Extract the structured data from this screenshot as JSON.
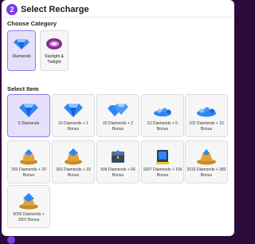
{
  "step": {
    "number": "2",
    "title": "Select Recharge"
  },
  "category_section": {
    "label": "Choose Category",
    "items": [
      {
        "label": "Diamonds",
        "selected": true
      },
      {
        "label": "Starlight & Twilight",
        "selected": false
      }
    ]
  },
  "item_section": {
    "label": "Select Item",
    "items": [
      {
        "label": "5 Diamonds",
        "selected": true
      },
      {
        "label": "10 Diamonds + 1 Bonus"
      },
      {
        "label": "20 Diamonds + 2 Bonus"
      },
      {
        "label": "51 Diamonds + 5 Bonus"
      },
      {
        "label": "102 Diamonds + 10 Bonus"
      },
      {
        "label": "203 Diamonds + 20 Bonus"
      },
      {
        "label": "303 Diamonds + 33 Bonus"
      },
      {
        "label": "504 Diamonds + 66 Bonus"
      },
      {
        "label": "1007 Diamonds + 156 Bonus"
      },
      {
        "label": "2015 Diamonds + 383 Bonus"
      },
      {
        "label": "5035 Diamonds + 1007 Bonus"
      }
    ]
  },
  "colors": {
    "accent": "#7b3fe4",
    "selected_bg": "#e7e0fb",
    "diamond": "#2f86f6"
  }
}
